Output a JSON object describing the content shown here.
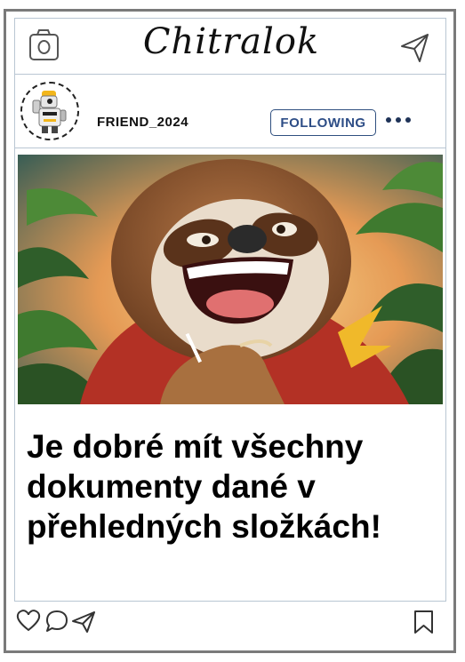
{
  "app": {
    "title": "Chitralok"
  },
  "profile": {
    "username": "FRIEND_2024",
    "follow_label": "FOLLOWING"
  },
  "post": {
    "caption": "Je dobré mít všechny dokumenty dané v přehledných složkách!",
    "image_alt": "Cartoon sloth laughing"
  },
  "icons": {
    "camera": "camera-icon",
    "send": "paper-plane-icon",
    "more": "more-dots-icon",
    "like": "heart-icon",
    "comment": "comment-icon",
    "share": "paper-plane-icon",
    "save": "bookmark-icon"
  },
  "colors": {
    "follow_text": "#2d4d86",
    "dots": "#1f3358",
    "frame": "#7a7a7a",
    "divider": "#b9c6d3"
  }
}
